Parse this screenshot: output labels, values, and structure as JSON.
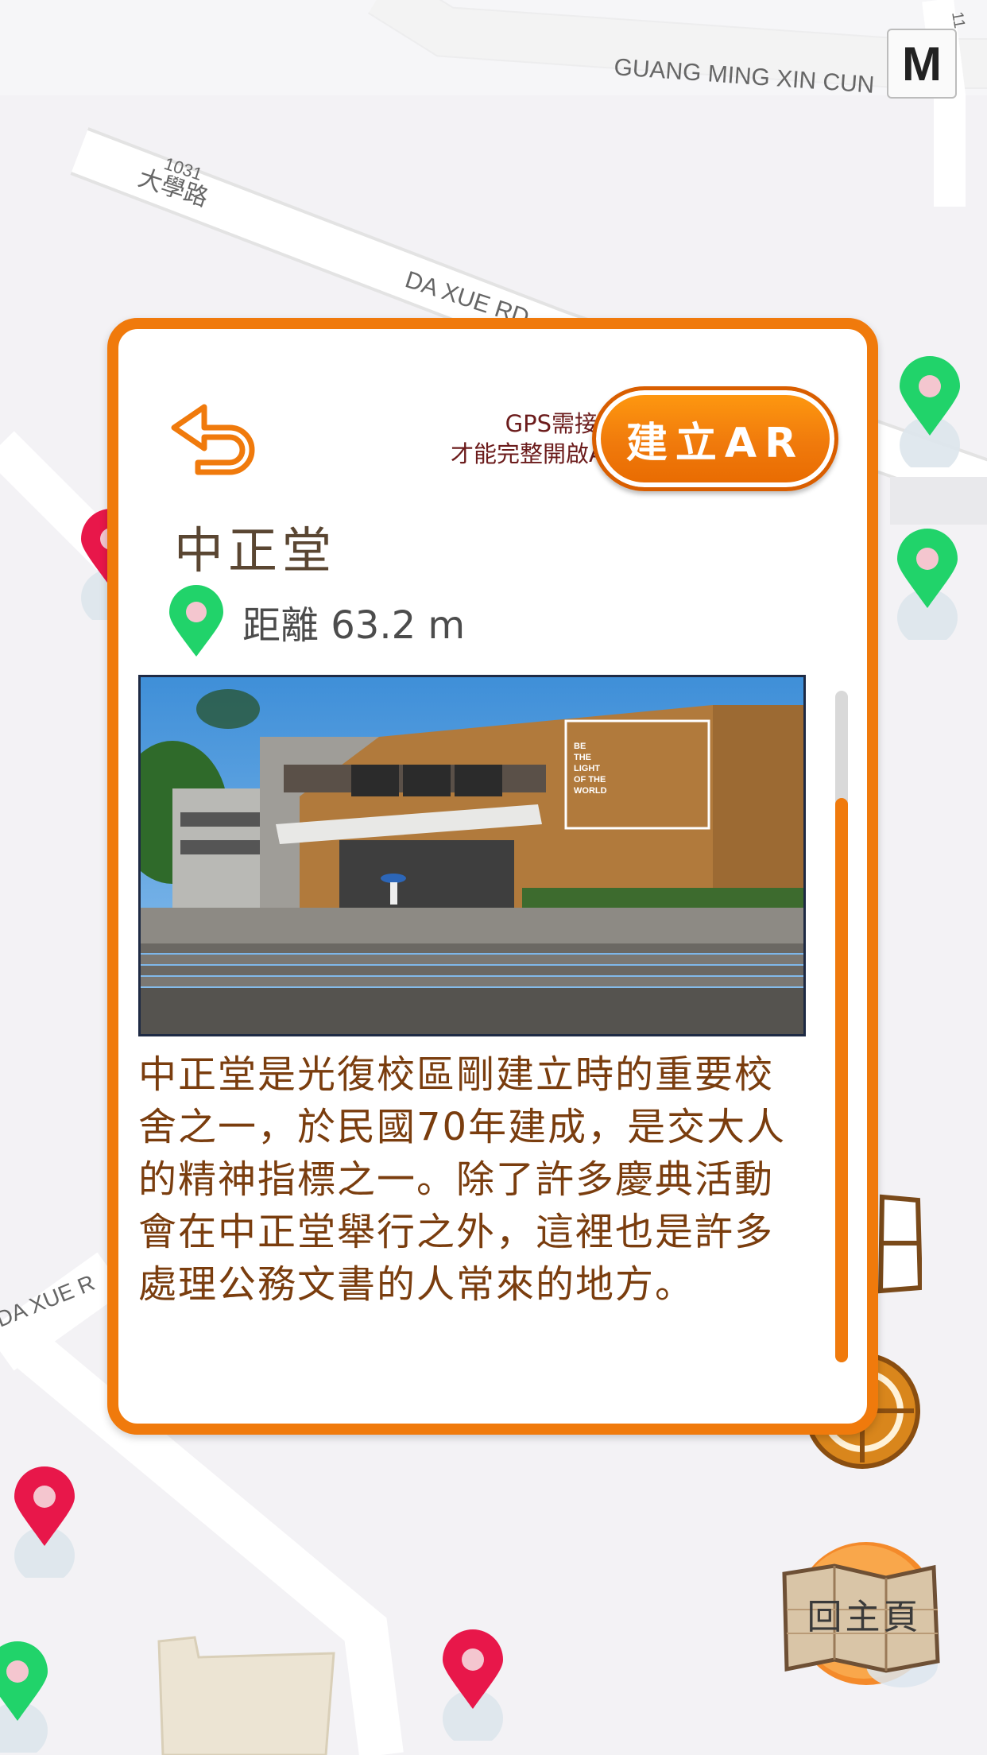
{
  "map": {
    "road_labels": {
      "guang_ming": "GUANG MING XIN CUN",
      "daxue_number": "1031",
      "daxue_zh": "大學路",
      "daxue_en_top": "DA XUE RD",
      "daxue_en_bottom": "DA XUE R",
      "corner_number": "11"
    },
    "mode_button_label": "M",
    "home_button_label": "回主頁"
  },
  "panel": {
    "gps_notice_line1": "GPS需接近地點",
    "gps_notice_line2": "才能完整開啟AR觀看",
    "ar_button_label": "建立AR",
    "title": "中正堂",
    "distance": "距離 63.2 m",
    "photo_sign": [
      "BE",
      "THE",
      "LIGHT",
      "OF THE",
      "WORLD"
    ],
    "description": "中正堂是光復校區剛建立時的重要校舍之一，於民國70年建成，是交大人的精神指標之一。除了許多慶典活動會在中正堂舉行之外，這裡也是許多處理公務文書的人常來的地方。"
  },
  "colors": {
    "accent": "#f07a0c",
    "pin_green": "#21d36a",
    "pin_red": "#e8174a",
    "description_text": "#7a3d0e"
  },
  "icons": {
    "back": "return-arrow-icon",
    "distance": "location-pin-icon",
    "home": "folded-map-icon",
    "locate": "target-icon"
  }
}
